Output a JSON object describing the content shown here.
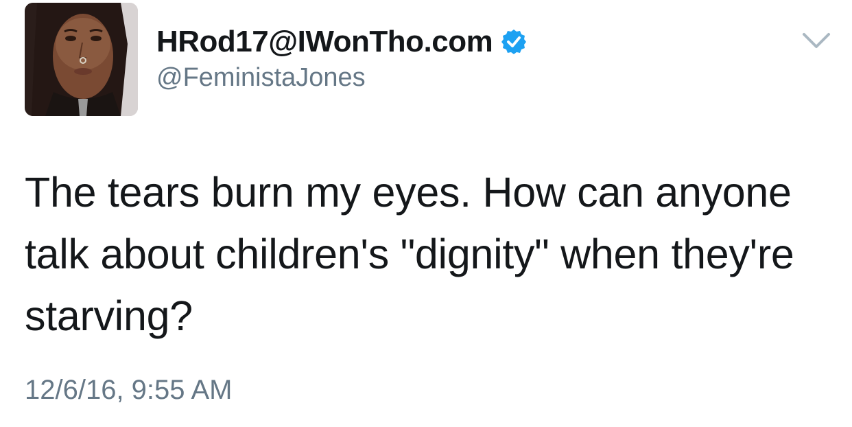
{
  "tweet": {
    "author": {
      "display_name": "HRod17@IWonTho.com",
      "handle": "@FeministaJones",
      "verified": true,
      "avatar_icon": "profile-photo"
    },
    "menu_icon": "chevron-down-icon",
    "text": "The tears burn my eyes. How can anyone talk about children's \"dignity\" when they're starving?",
    "timestamp": "12/6/16, 9:55 AM"
  },
  "colors": {
    "text": "#14171a",
    "secondary": "#657786",
    "verified_badge": "#1da1f2",
    "chevron": "#aab8c2"
  }
}
